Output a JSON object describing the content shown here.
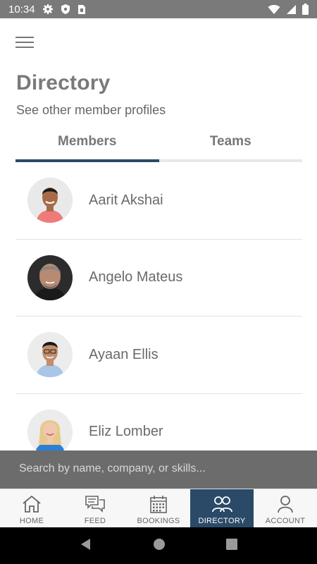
{
  "status_bar": {
    "time": "10:34",
    "icons": [
      "gear-icon",
      "shield-icon",
      "sim-card-icon",
      "wifi-icon",
      "cellular-signal-icon",
      "battery-icon"
    ]
  },
  "header": {
    "menu_icon": "hamburger-menu-icon",
    "title": "Directory",
    "subtitle": "See other member profiles"
  },
  "tabs": [
    {
      "label": "Members",
      "active": true
    },
    {
      "label": "Teams",
      "active": false
    }
  ],
  "members": [
    {
      "name": "Aarit Akshai",
      "avatar_bg": "#e9e9e9",
      "shirt": "#f07a7a",
      "skin": "#a66c4a",
      "hair": "#1e1a18"
    },
    {
      "name": "Angelo Mateus",
      "avatar_bg": "#2c2c2c",
      "shirt": "#1a1a1a",
      "skin": "#b98a72",
      "hair": "#6f6a66"
    },
    {
      "name": "Ayaan Ellis",
      "avatar_bg": "#ececec",
      "shirt": "#a9c6e8",
      "skin": "#c48d6b",
      "hair": "#1c1a1a"
    },
    {
      "name": "Eliz Lomber",
      "avatar_bg": "#ececec",
      "shirt": "#2b7fd6",
      "skin": "#f0c8ae",
      "hair": "#e6c98a"
    }
  ],
  "search": {
    "placeholder": "Search by name, company, or skills..."
  },
  "bottom_nav": [
    {
      "label": "HOME",
      "icon": "home-icon",
      "active": false
    },
    {
      "label": "FEED",
      "icon": "chat-bubbles-icon",
      "active": false
    },
    {
      "label": "BOOKINGS",
      "icon": "calendar-icon",
      "active": false
    },
    {
      "label": "DIRECTORY",
      "icon": "people-icon",
      "active": true
    },
    {
      "label": "ACCOUNT",
      "icon": "person-icon",
      "active": false
    }
  ],
  "system_nav": [
    "back-icon",
    "home-circle-icon",
    "recents-icon"
  ],
  "colors": {
    "accent": "#2a4a68",
    "status_bar": "#7a7a7a",
    "search_bar": "#6c6c6c"
  }
}
